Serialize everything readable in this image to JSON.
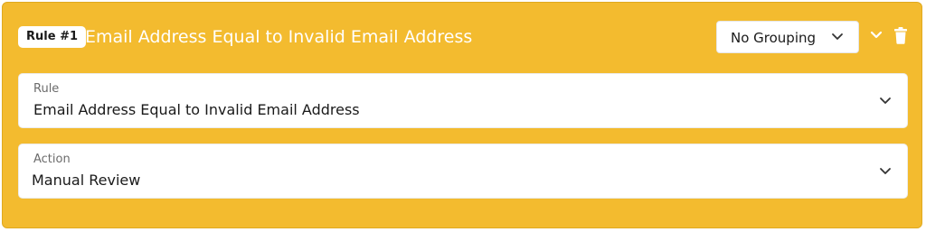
{
  "rule": {
    "badge": "Rule #1",
    "title": "Email Address Equal to Invalid Email Address"
  },
  "grouping": {
    "selected": "No Grouping",
    "icon": "chevron-down-icon"
  },
  "header_actions": {
    "collapse_icon": "chevron-down-icon",
    "delete_icon": "trash-icon"
  },
  "fields": {
    "rule": {
      "label": "Rule",
      "value": "Email Address Equal to Invalid Email Address"
    },
    "action": {
      "label": "Action",
      "value": "Manual Review"
    }
  },
  "colors": {
    "card_background": "#f3bb2f",
    "title_text": "#ffffff",
    "field_background": "#ffffff"
  }
}
